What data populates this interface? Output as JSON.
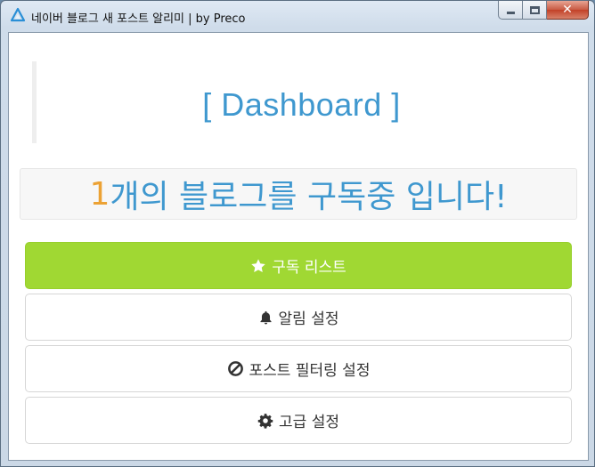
{
  "window": {
    "title": "네이버 블로그 새 포스트 알리미 | by Preco",
    "close_glyph": "✕"
  },
  "dashboard": {
    "heading": "[ Dashboard ]"
  },
  "summary": {
    "count": "1",
    "text": "개의 블로그를 구독중 입니다!"
  },
  "menu": [
    {
      "label": "구독 리스트",
      "icon": "star-icon"
    },
    {
      "label": "알림 설정",
      "icon": "bell-icon"
    },
    {
      "label": "포스트 필터링 설정",
      "icon": "ban-icon"
    },
    {
      "label": "고급 설정",
      "icon": "gear-icon"
    }
  ],
  "colors": {
    "accent": "#3f98cf",
    "count": "#eca234",
    "primary_button": "#a0d833"
  }
}
